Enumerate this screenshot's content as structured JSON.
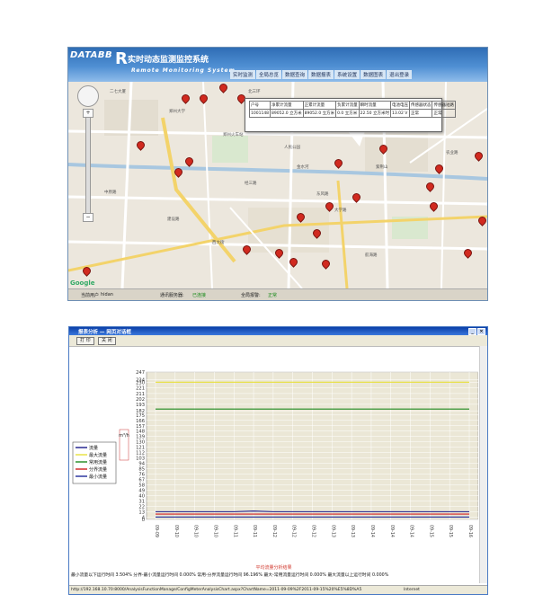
{
  "monitor": {
    "logo": "DATABB",
    "title": "实时动态监测监控系统",
    "subtitle": "Remote Monitoring System",
    "menu": [
      "实时监测",
      "全局总览",
      "数据查询",
      "数据报表",
      "系统设置",
      "数据图表",
      "退出登录"
    ],
    "popup": {
      "headers": [
        "户号",
        "净累计流量",
        "正累计流量",
        "负累计流量",
        "瞬时流量",
        "电池电压",
        "传感器状态",
        "传感器短路"
      ],
      "row": [
        "1001148",
        "89052.0 立方米",
        "89052.0 立方米",
        "0.0 立方米",
        "22.50 立方米时",
        "13.02 V",
        "正常",
        "正常"
      ]
    },
    "map_labels": [
      "二七大厦",
      "郑州大学",
      "郑州火车站",
      "人民公园",
      "紫荆山",
      "金水河",
      "中原路",
      "建设路",
      "大学路",
      "航海路",
      "经三路",
      "东风路",
      "农业路",
      "西大街",
      "北三环"
    ],
    "google": "Google",
    "status": {
      "user_label": "当前用户",
      "user": "hidan",
      "server_label": "通讯服务器:",
      "server": "已连接",
      "alarm_label": "全局报警:",
      "alarm": "正常"
    }
  },
  "analysis": {
    "window_title": "报表分析 — 网页对话框",
    "print": "打 印",
    "close": "关 闭",
    "summary_title": "平均流量分析结果",
    "summary": "最小流量以下运行时间 3.504%   分界-最小流量运行时间 0.000%   常用-分界流量运行时间 96.196%   最大-常用流量运行时间 0.000%   最大流量以上运行时间 0.000%",
    "url": "http://192.168.10.70:8000/AnalysisFunctionManage/ConfigMeterAnalysisChart.aspx?ChartName=2011-09-09%2F2011-09-15%20%E5%8D%A5",
    "zone": "Internet"
  },
  "chart_data": {
    "type": "line",
    "ylabel": "m³/h",
    "ylim": [
      0,
      247
    ],
    "yticks": [
      0,
      4,
      13,
      22,
      31,
      40,
      49,
      58,
      67,
      76,
      85,
      94,
      103,
      112,
      121,
      130,
      139,
      148,
      157,
      166,
      175,
      182,
      193,
      202,
      211,
      221,
      230,
      234,
      247
    ],
    "x": [
      "09-09",
      "09-10",
      "09-10",
      "09-10",
      "09-11",
      "09-11",
      "09-12",
      "09-12",
      "09-12",
      "09-13",
      "09-13",
      "09-14",
      "09-14",
      "09-14",
      "09-15",
      "09-15",
      "09-16"
    ],
    "legend_position": "left",
    "grid": true,
    "series": [
      {
        "name": "流量",
        "color": "#1a1a8a",
        "values": [
          13,
          13,
          13,
          13,
          13,
          14,
          13,
          13,
          13,
          13,
          13,
          13,
          13,
          13,
          13,
          13,
          13
        ]
      },
      {
        "name": "最大流量",
        "color": "#e8e03a",
        "values": [
          230,
          230,
          230,
          230,
          230,
          230,
          230,
          230,
          230,
          230,
          230,
          230,
          230,
          230,
          230,
          230,
          230
        ]
      },
      {
        "name": "常用流量",
        "color": "#1e8a1e",
        "values": [
          185,
          185,
          185,
          185,
          185,
          185,
          185,
          185,
          185,
          185,
          185,
          185,
          185,
          185,
          185,
          185,
          185
        ]
      },
      {
        "name": "分界流量",
        "color": "#d02020",
        "values": [
          9,
          9,
          9,
          9,
          9,
          9,
          9,
          9,
          9,
          9,
          9,
          9,
          9,
          9,
          9,
          9,
          9
        ]
      },
      {
        "name": "最小流量",
        "color": "#1e2a9a",
        "values": [
          4,
          4,
          4,
          4,
          4,
          4,
          4,
          4,
          4,
          4,
          4,
          4,
          4,
          4,
          4,
          4,
          4
        ]
      }
    ]
  }
}
